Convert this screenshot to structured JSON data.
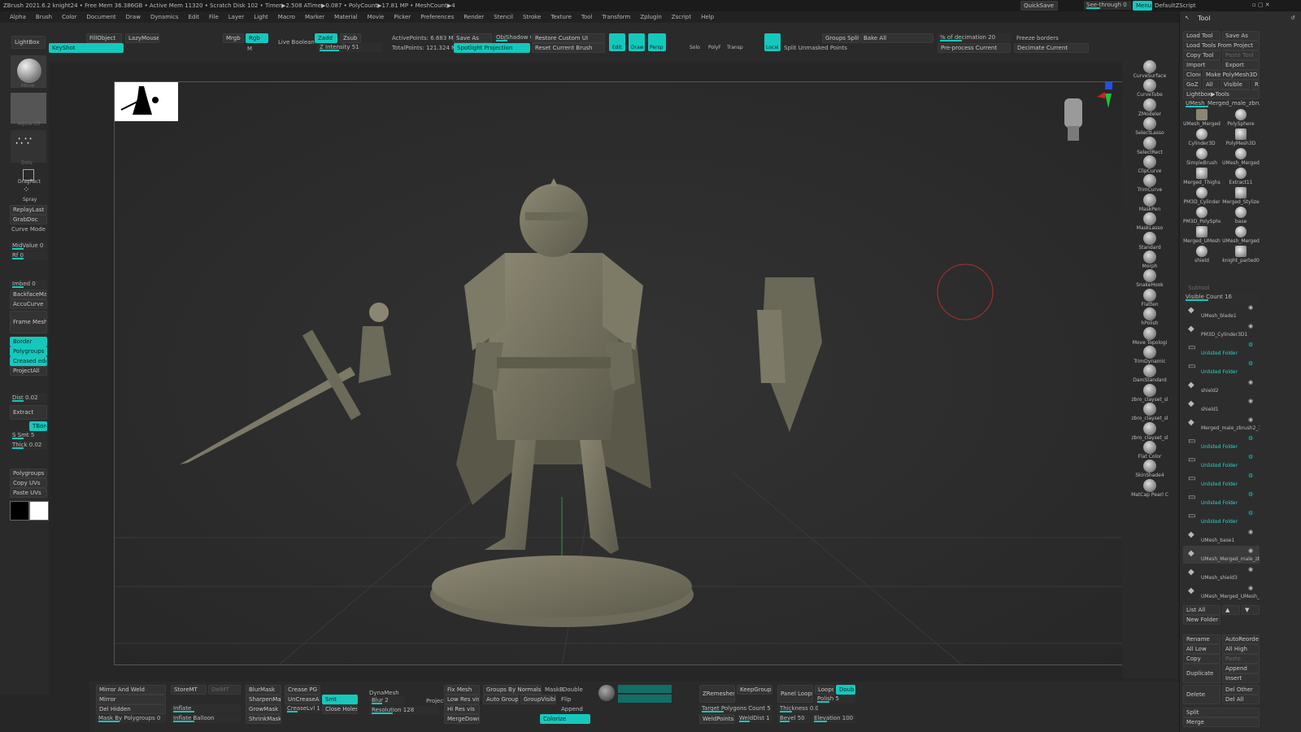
{
  "titlebar": {
    "text": "ZBrush 2021.6.2   knight24   • Free Mem 36.386GB • Active Mem 11320 • Scratch Disk 102 • Timer▶2.508 ATime▶0.087 • PolyCount▶17.81 MP • MeshCount▶4",
    "quicksave": "QuickSave",
    "see_through": "See-through 0",
    "menus": "Menus",
    "default_zscript": "DefaultZScript"
  },
  "menubar": [
    "Alpha",
    "Brush",
    "Color",
    "Document",
    "Draw",
    "Dynamics",
    "Edit",
    "File",
    "Layer",
    "Light",
    "Macro",
    "Marker",
    "Material",
    "Movie",
    "Picker",
    "Preferences",
    "Render",
    "Stencil",
    "Stroke",
    "Texture",
    "Tool",
    "Transform",
    "Zplugin",
    "Zscript",
    "Help"
  ],
  "topshelf": {
    "lightbox": "LightBox",
    "keyshot": "KeyShot",
    "fill_object": "FillObject",
    "lazy_mouse": "LazyMouse",
    "mrgb": "Mrgb",
    "rgb": "Rgb",
    "m": "M",
    "live_boolean": "Live Boolean",
    "zadd": "Zadd",
    "zsub": "Zsub",
    "z_intensity": "Z Intensity 51",
    "active_points": "ActivePoints: 6.683 Mil",
    "total_points": "TotalPoints: 121.324 Mil",
    "save_as": "Save As",
    "obj_shadow": "ObjShadow 0",
    "spotlight_projection": "Spotlight Projection",
    "restore_custom_ui": "Restore Custom UI",
    "reset_current_brush": "Reset Current Brush",
    "edit": "Edit",
    "draw": "Draw",
    "persp": "Persp",
    "solo": "Solo",
    "polyf": "PolyF",
    "transp": "Transp",
    "local": "Local",
    "groups_split": "Groups Split",
    "split_unmasked_points": "Split Unmasked Points",
    "bake_all": "Bake All",
    "pct_decimation": "% of decimation 20",
    "preprocess_current": "Pre-process Current",
    "freeze_borders": "Freeze borders",
    "decimate_current": "Decimate Current"
  },
  "leftshelf": {
    "move": "Move",
    "alpha_off": "Alpha Off",
    "dots": "Dots",
    "dragrect": "DragRect",
    "spray": "Spray",
    "replay_last": "ReplayLast",
    "grab_doc": "GrabDoc",
    "curve_mode": "Curve Mode",
    "mid_value": "MidValue 0",
    "rf": "Rf 0",
    "imbed": "Imbed 0",
    "backface_mask": "BackfaceMask",
    "accu_curve": "AccuCurve",
    "frame_mesh": "Frame Mesh",
    "border": "Border",
    "polygroups": "Polygroups",
    "creased_edges": "Creased edges",
    "project_all": "ProjectAll",
    "dist": "Dist 0.02",
    "extract": "Extract",
    "tbord": "TBord",
    "s_smt": "S Smt 5",
    "thick": "Thick 0.02",
    "polygroups2": "Polygroups",
    "copy_uvs": "Copy UVs",
    "paste_uvs": "Paste UVs"
  },
  "rightshelf": [
    "CurveSurface",
    "CurveTube",
    "ZModeler",
    "SelectLasso",
    "SelectRect",
    "ClipCurve",
    "TrimCurve",
    "MaskPen",
    "MaskLasso",
    "Standard",
    "Morph",
    "SnakeHook",
    "Flatten",
    "hPolish",
    "Move Topologi",
    "TrimDynamic",
    "DamStandard",
    "zbro_clayset_sl",
    "zbro_clayset_sl",
    "zbro_clayset_sl",
    "Flat Color",
    "SkinShade4",
    "MatCap Pearl C"
  ],
  "tool_panel": {
    "title": "Tool",
    "load_tool": "Load Tool",
    "save_as": "Save As",
    "load_tools_from_project": "Load Tools From Project",
    "copy_tool": "Copy Tool",
    "paste_tool": "Paste Tool",
    "import": "Import",
    "export": "Export",
    "clone": "Clone",
    "make_polymesh3d": "Make PolyMesh3D",
    "goz": "GoZ",
    "all": "All",
    "visible": "Visible",
    "r": "R",
    "lightbox_tools": "Lightbox▶Tools",
    "current_tool": "UMesh_Merged_male_zbru",
    "tools": [
      "UMesh_Merged",
      "PolySphere",
      "Cylinder3D",
      "PolyMesh3D",
      "SimpleBrush",
      "UMesh_Merged",
      "Merged_Thighs",
      "Extract11",
      "PM3D_Cylinder",
      "Merged_Stylize",
      "PM3D_PolySphe",
      "base",
      "Merged_UMesh",
      "UMesh_Merged",
      "shield",
      "knight_parted0"
    ]
  },
  "subtool": {
    "header": "Subtool",
    "visible_count": "Visible Count 16",
    "items": [
      "UMesh_blade1",
      "PM3D_Cylinder3D1",
      "Unlisted Folder",
      "Unlisted Folder",
      "shield2",
      "shield1",
      "Merged_male_zbrush2_1t",
      "Unlisted Folder",
      "Unlisted Folder",
      "Unlisted Folder",
      "Unlisted Folder",
      "Unlisted Folder",
      "UMesh_base1",
      "UMesh_Merged_male_zbrus",
      "UMesh_shield3",
      "UMesh_Merged_UMesh_blad"
    ],
    "list_all": "List All",
    "new_folder": "New Folder",
    "rename": "Rename",
    "auto_reorder": "AutoReorder",
    "all_low": "All Low",
    "all_high": "All High",
    "copy": "Copy",
    "paste": "Paste",
    "duplicate": "Duplicate",
    "append": "Append",
    "insert": "Insert",
    "delete": "Delete",
    "del_other": "Del Other",
    "del_all": "Del All",
    "split": "Split",
    "merge": "Merge"
  },
  "bottomshelf": {
    "mirror_and_weld": "Mirror And Weld",
    "mirror": "Mirror",
    "del_hidden": "Del Hidden",
    "mask_by_polygroups": "Mask By Polygroups 0",
    "store_mt": "StoreMT",
    "del_mt": "DelMT",
    "inflate": "Inflate",
    "inflate_balloon": "Inflate Balloon",
    "blur_mask": "BlurMask",
    "sharpen_mask": "SharpenMask",
    "grow_mask": "GrowMask",
    "shrink_mask": "ShrinkMask",
    "crease_pg": "Crease PG",
    "uncrease_all": "UnCreaseAll",
    "crease_lvl": "CreaseLvl 15",
    "smt": "Smt",
    "close_holes": "Close Holes",
    "dynamesh": "DynaMesh",
    "blur": "Blur 2",
    "project": "Project",
    "resolution": "Resolution 128",
    "fix_mesh": "Fix Mesh",
    "low_res_vis": "Low Res vis",
    "hi_res_vis": "Hi Res vis",
    "merge_down": "MergeDown",
    "groups_by_normals": "Groups By Normals",
    "maskb": "MaskB",
    "double": "Double",
    "auto_groups": "Auto Groups",
    "group_visible": "GroupVisible",
    "flip": "Flip",
    "append": "Append",
    "colorize": "Colorize",
    "zremesher": "ZRemesher",
    "keep_groups": "KeepGroups",
    "panel_loops": "Panel Loops",
    "loops": "Loops",
    "double2": "Double",
    "polish": "Polish 5",
    "target_polygons": "Target Polygons Count 5",
    "thickness": "Thickness 0.01",
    "weld_points": "WeldPoints",
    "weld_dist": "WeldDist 1",
    "bevel": "Bevel 50",
    "elevation": "Elevation 100"
  }
}
